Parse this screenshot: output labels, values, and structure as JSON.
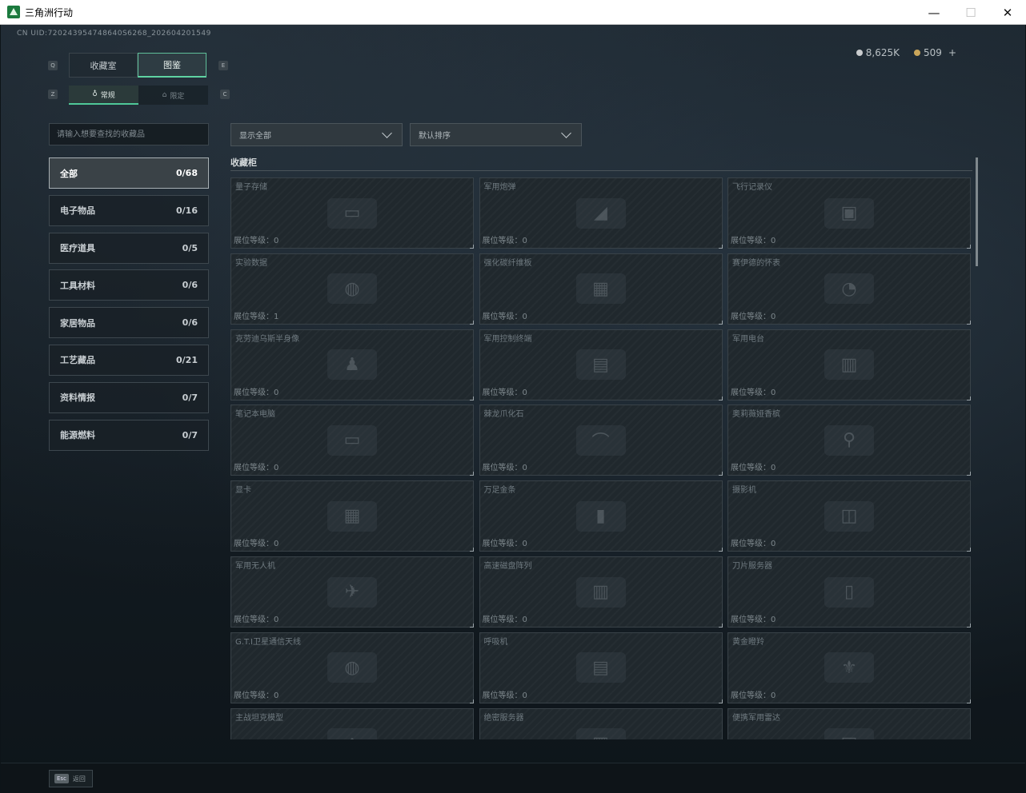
{
  "window": {
    "title": "三角洲行动",
    "minimize": "—",
    "maximize": "☐",
    "close": "✕"
  },
  "header": {
    "uid": "CN UID:720243954748640S6268_202604201549",
    "currency_silver": "8,625K",
    "currency_gold": "509",
    "add": "+"
  },
  "keys": {
    "q": "Q",
    "e": "E",
    "z": "Z",
    "c": "C"
  },
  "top_tabs": [
    {
      "label": "收藏室",
      "active": false
    },
    {
      "label": "图鉴",
      "active": true
    }
  ],
  "sub_tabs": [
    {
      "label": "常规",
      "icon": "collection-icon",
      "active": true
    },
    {
      "label": "限定",
      "icon": "limited-icon",
      "active": false
    }
  ],
  "search": {
    "placeholder": "请输入想要查找的收藏品"
  },
  "filters": {
    "show": "显示全部",
    "sort": "默认排序"
  },
  "categories": [
    {
      "label": "全部",
      "count": "0/68",
      "active": true
    },
    {
      "label": "电子物品",
      "count": "0/16"
    },
    {
      "label": "医疗道具",
      "count": "0/5"
    },
    {
      "label": "工具材料",
      "count": "0/6"
    },
    {
      "label": "家居物品",
      "count": "0/6"
    },
    {
      "label": "工艺藏品",
      "count": "0/21"
    },
    {
      "label": "资料情报",
      "count": "0/7"
    },
    {
      "label": "能源燃料",
      "count": "0/7"
    }
  ],
  "section_title": "收藏柜",
  "items": [
    {
      "name": "量子存储",
      "level": "展位等级：0"
    },
    {
      "name": "军用炮弹",
      "level": "展位等级：0"
    },
    {
      "name": "飞行记录仪",
      "level": "展位等级：0"
    },
    {
      "name": "实验数据",
      "level": "展位等级：1"
    },
    {
      "name": "强化碳纤维板",
      "level": "展位等级：0"
    },
    {
      "name": "赛伊德的怀表",
      "level": "展位等级：0"
    },
    {
      "name": "克劳迪乌斯半身像",
      "level": "展位等级：0"
    },
    {
      "name": "军用控制终端",
      "level": "展位等级：0"
    },
    {
      "name": "军用电台",
      "level": "展位等级：0"
    },
    {
      "name": "笔记本电脑",
      "level": "展位等级：0"
    },
    {
      "name": "棘龙爪化石",
      "level": "展位等级：0"
    },
    {
      "name": "奥莉薇娅香槟",
      "level": "展位等级：0"
    },
    {
      "name": "显卡",
      "level": "展位等级：0"
    },
    {
      "name": "万足金条",
      "level": "展位等级：0"
    },
    {
      "name": "摄影机",
      "level": "展位等级：0"
    },
    {
      "name": "军用无人机",
      "level": "展位等级：0"
    },
    {
      "name": "高速磁盘阵列",
      "level": "展位等级：0"
    },
    {
      "name": "刀片服务器",
      "level": "展位等级：0"
    },
    {
      "name": "G.T.I卫星通信天线",
      "level": "展位等级：0"
    },
    {
      "name": "呼吸机",
      "level": "展位等级：0"
    },
    {
      "name": "黄金瞪羚",
      "level": "展位等级：0"
    },
    {
      "name": "主战坦克模型",
      "level": ""
    },
    {
      "name": "绝密服务器",
      "level": ""
    },
    {
      "name": "便携军用雷达",
      "level": ""
    }
  ],
  "footer": {
    "esc_key": "Esc",
    "back": "返回"
  }
}
